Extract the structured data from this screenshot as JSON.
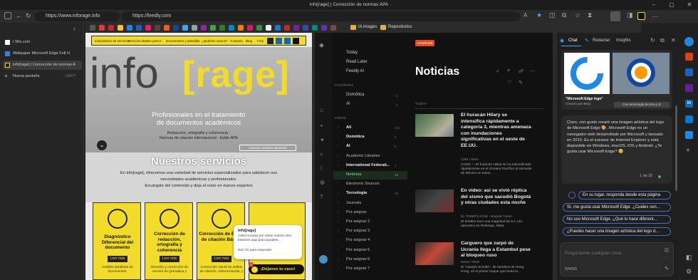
{
  "window": {
    "title": "info[rage] | Corrección de normas APA"
  },
  "address": {
    "url1": "https://www.inforage.info",
    "url2": "https://feedly.com"
  },
  "tabs": [
    {
      "label": "| Wix.com"
    },
    {
      "label": "Wallpaper Microsoft Edge Full H"
    },
    {
      "label": "info[rage] | Corrección de normas A"
    },
    {
      "label": "Nueva pestaña",
      "shortcut": "Ctrl+T"
    }
  ],
  "favorites": {
    "folder1": "IA images",
    "folder2": "Repositorios"
  },
  "inforage": {
    "nav": [
      "Calculadora de servicios",
      "Servicios ideales para ti",
      "Documentos y plantillas",
      "¿Quiénes somos?",
      "Contacto",
      "Blog",
      "FAQ"
    ],
    "logo_left": "info",
    "logo_right": "[rage]",
    "tagline1": "Profesionales en el tratamiento",
    "tagline2": "de documentos académicos",
    "sub1": "Redacción, ortografía y coherencia ·",
    "sub2": "Normas de citación internacional · Estilo APA",
    "cta": "Conoce nuestros servicios",
    "services_title": "Nuestros servicios",
    "services_p1": "En info[rage], ofrecemos una variedad de servicios especializados para satisfacer sus",
    "services_p2": "necesidades académicas y profesionales.",
    "services_p3": "Encárgate del contenido y deja el resto en manos expertos",
    "card1_title": "Diagnóstico Diferencial del documento",
    "card1_desc": "Análisis detallado de documentos,",
    "card2_title": "Corrección de redacción, ortografía y coherencia",
    "card2_desc": "Revisión y corrección de errores de gramática y",
    "card3_title": "Corrección de Estilo de citación Básica",
    "card3_desc": "Corrección visual de estilos de citación, referenciación, y",
    "read_more": "Leer más",
    "chat_name": "Info[rage]",
    "chat_msg1": "¡Hola! Gracias por visitar nuestro sitio. Estamos aquí para ayudarte...",
    "chat_msg2": "Haz clic para responder",
    "chat_btn": "¡Déjanos tu caso!",
    "chat_badge": "1"
  },
  "feedly": {
    "upgrade": "UPGRADE",
    "top": [
      "Today",
      "Read Later",
      "Feedly AI"
    ],
    "favorites_label": "FAVORITES",
    "favorites": [
      {
        "name": "Domótica",
        "count": "6"
      },
      {
        "name": "AI",
        "count": "6"
      }
    ],
    "feeds_label": "FEEDS",
    "feeds": [
      {
        "name": "All",
        "count": "101",
        "bold": true
      },
      {
        "name": "Domótica",
        "count": "6",
        "bold": true
      },
      {
        "name": "AI",
        "count": "6",
        "bold": true
      },
      {
        "name": "Academic Libraries",
        "count": "",
        "bold": false
      },
      {
        "name": "International Federati...",
        "count": "1",
        "bold": true
      },
      {
        "name": "Noticias",
        "count": "14",
        "bold": true,
        "active": true
      },
      {
        "name": "Electronic Sources",
        "count": "",
        "bold": false
      },
      {
        "name": "Tecnología",
        "count": "19",
        "bold": true
      },
      {
        "name": "Journals",
        "count": "",
        "bold": false
      },
      {
        "name": "Por asignar",
        "count": "",
        "bold": false
      },
      {
        "name": "Por asignar 2",
        "count": "",
        "bold": false
      },
      {
        "name": "Por asignar 3",
        "count": "",
        "bold": false
      },
      {
        "name": "Por asignar 4",
        "count": "",
        "bold": false
      },
      {
        "name": "Por asignar 5",
        "count": "",
        "bold": false
      },
      {
        "name": "Por asignar 6",
        "count": "",
        "bold": false
      },
      {
        "name": "Por asignar 7",
        "count": "",
        "bold": false
      }
    ],
    "heading": "Noticias",
    "today": "TODAY",
    "articles": [
      {
        "title": "El huracán Hilary se intensifica rápidamente a categoría 3, mientras amenaza con inundaciones significativas en el oeste de EE.UU.",
        "meta": "CNN / 5min",
        "summary": "(CNN) — El huracán Hilary se ha intensificado rápidamente en el Océano Pacífico al suroeste de México en estos..."
      },
      {
        "title": "En video: así se vivió réplica del sismo que sacudió Bogotá y otras ciudades esta noche",
        "meta": "EL TIEMPO.COM - Bogotá / 5min",
        "summary": "El temblor tuvo una magnitud de 5.1 con epicentro en Restrepo, Meta"
      },
      {
        "title": "Carguero que zarpó de Ucrania llega a Estambul pese al bloqueo ruso",
        "meta": "News / 9min",
        "summary": "El \"Joseph Schulte\", de bandera de Hong Kong, es el primer buque que burla la..."
      }
    ]
  },
  "copilot": {
    "tabs": [
      "Chat",
      "Redactar",
      "Insights"
    ],
    "img_caption": "\"Microsoft Edge logo\"",
    "img_credit": "Creado por Bing",
    "img_badge": "Con tecnología de DALL·E",
    "message": "Claro, con gusto crearé una imagen artística del logo de Microsoft Edge 🎨. Microsoft Edge es un navegador web desarrollado por Microsoft y lanzado en 2015. Es el sucesor de Internet Explorer y está disponible en Windows, macOS, iOS y Android. ¿Te gusta usar Microsoft Edge? 😊",
    "counter": "1 de 30",
    "suggestions": [
      "En su lugar, responda desde esta página",
      "Sí, me gusta usar Microsoft Edge. ¿Cuáles son...",
      "No uso Microsoft Edge. ¿Qué lo hace diferent...",
      "¿Puedes hacer una imagen artística del logo d..."
    ],
    "placeholder": "Pregúntame cualquier cosa",
    "charcount": "0/4000"
  }
}
